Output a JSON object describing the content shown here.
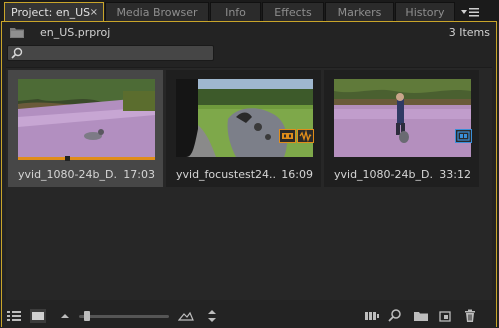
{
  "tabs": [
    {
      "label": "Project: en_US",
      "active": true
    },
    {
      "label": "Media Browser"
    },
    {
      "label": "Info"
    },
    {
      "label": "Effects"
    },
    {
      "label": "Markers"
    },
    {
      "label": "History"
    }
  ],
  "tab_close_glyph": "×",
  "project": {
    "filename": "en_US.prproj",
    "items_count": "3 Items"
  },
  "search": {
    "value": "",
    "placeholder": ""
  },
  "clips": [
    {
      "name": "yvid_1080-24b_D...",
      "duration": "17:03",
      "selected": true,
      "progress": 0.36
    },
    {
      "name": "yvid_focustest24...",
      "duration": "16:09",
      "selected": false,
      "badges": [
        "audio-video-badge",
        "audio-badge"
      ]
    },
    {
      "name": "yvid_1080-24b_D...",
      "duration": "33:12",
      "selected": false,
      "badges": [
        "video-badge"
      ]
    }
  ],
  "toolbar": {
    "zoom_level": 0.05,
    "icons": [
      "list-view-icon",
      "icon-view-icon",
      "zoom-out-icon",
      "zoom-slider",
      "zoom-in-icon",
      "sort-icon",
      "automate-to-sequence-icon",
      "find-icon",
      "new-bin-icon",
      "new-item-icon",
      "trash-icon"
    ]
  },
  "colors": {
    "accent": "#c9a52a",
    "progress": "#e08d1a",
    "badge_blue": "#3a8fd8"
  }
}
